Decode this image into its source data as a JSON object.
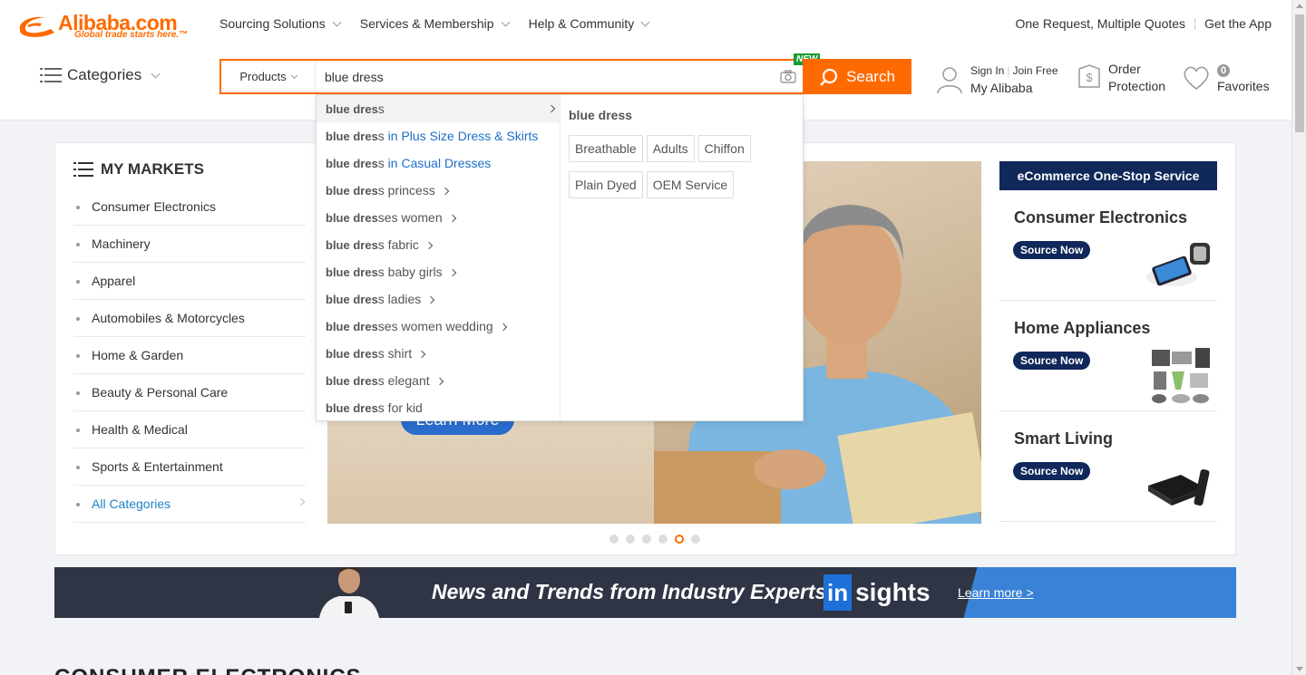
{
  "logo": {
    "name": "Alibaba.com",
    "tagline": "Global trade starts here.™"
  },
  "topnav": [
    "Sourcing Solutions",
    "Services & Membership",
    "Help & Community"
  ],
  "topright": {
    "quotes": "One Request, Multiple Quotes",
    "app": "Get the App"
  },
  "categories_label": "Categories",
  "search": {
    "type": "Products",
    "value": "blue dress",
    "button": "Search",
    "new_badge": "NEW"
  },
  "user": {
    "sign_in": "Sign In",
    "join": "Join Free",
    "my_alibaba": "My Alibaba"
  },
  "order": {
    "line1": "Order",
    "line2": "Protection"
  },
  "favorites": {
    "count": "0",
    "label": "Favorites"
  },
  "markets": {
    "title": "MY MARKETS",
    "items": [
      "Consumer Electronics",
      "Machinery",
      "Apparel",
      "Automobiles & Motorcycles",
      "Home & Garden",
      "Beauty & Personal Care",
      "Health & Medical",
      "Sports & Entertainment",
      "All Categories"
    ]
  },
  "banner": {
    "button": "Learn More"
  },
  "ecommerce": {
    "title": "eCommerce One-Stop Service",
    "cells": [
      {
        "title": "Consumer Electronics",
        "button": "Source Now"
      },
      {
        "title": "Home Appliances",
        "button": "Source Now"
      },
      {
        "title": "Smart Living",
        "button": "Source Now"
      }
    ]
  },
  "insights": {
    "headline": "News and Trends from Industry Experts",
    "logo_in": "in",
    "logo_rest": "sights",
    "link": "Learn more >"
  },
  "section_title": "CONSUMER ELECTRONICS",
  "suggestions": {
    "query_prefix": "blue dres",
    "items": [
      {
        "rest": "s",
        "category": ""
      },
      {
        "rest": "s",
        "category": " in Plus Size Dress & Skirts"
      },
      {
        "rest": "s",
        "category": " in Casual Dresses"
      },
      {
        "rest": "s princess",
        "category": ""
      },
      {
        "rest": "ses women",
        "category": ""
      },
      {
        "rest": "s fabric",
        "category": ""
      },
      {
        "rest": "s baby girls",
        "category": ""
      },
      {
        "rest": "s ladies",
        "category": ""
      },
      {
        "rest": "ses women wedding",
        "category": ""
      },
      {
        "rest": "s shirt",
        "category": ""
      },
      {
        "rest": "s elegant",
        "category": ""
      },
      {
        "rest": "s for kid",
        "category": ""
      }
    ],
    "side_title": "blue dress",
    "tags": [
      "Breathable",
      "Adults",
      "Chiffon",
      "Plain Dyed",
      "OEM Service"
    ]
  },
  "colors": {
    "brand": "#ff6a00",
    "navy": "#10285a",
    "link": "#1e6fc8",
    "new_badge": "#1a9a33"
  }
}
